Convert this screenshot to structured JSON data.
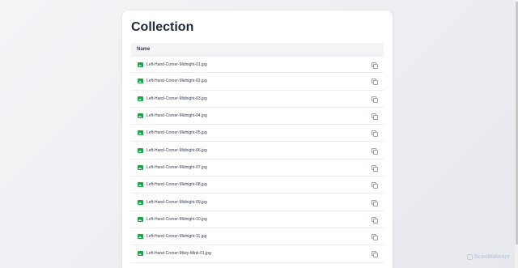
{
  "page": {
    "title": "Collection"
  },
  "table": {
    "header": "Name",
    "files": [
      "Left-Hand-Corner-Midnight-01.jpg",
      "Left-Hand-Corner-Midnight-02.jpg",
      "Left-Hand-Corner-Midnight-03.jpg",
      "Left-Hand-Corner-Midnight-04.jpg",
      "Left-Hand-Corner-Midnight-05.jpg",
      "Left-Hand-Corner-Midnight-06.jpg",
      "Left-Hand-Corner-Midnight-07.jpg",
      "Left-Hand-Corner-Midnight-08.jpg",
      "Left-Hand-Corner-Midnight-09.jpg",
      "Left-Hand-Corner-Midnight-10.jpg",
      "Left-Hand-Corner-Midnight-11.jpg",
      "Left-Hand-Corner-Misty-Mink-01.jpg"
    ]
  },
  "icons": {
    "file": "image-icon",
    "action": "copy-icon"
  },
  "colors": {
    "accent_green": "#22a34a",
    "title": "#1f2937",
    "watermark": "#c3ccdb"
  },
  "watermark": {
    "text": "ScanMalware"
  }
}
